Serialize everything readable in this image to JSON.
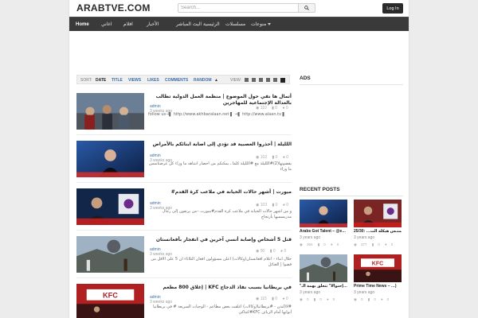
{
  "header": {
    "logo": "ARABTVE.COM",
    "search_placeholder": "Search...",
    "login_label": "Log In"
  },
  "nav": {
    "home": "Home",
    "items": [
      "منوعات",
      "مسلسلات",
      "الرئيسية",
      "البث المباشر",
      "الأخبار",
      "افلام",
      "اغاني"
    ]
  },
  "sortbar": {
    "sort_label": "SORT:",
    "options": [
      "DATE",
      "TITLE",
      "VIEWS",
      "LIKES",
      "COMMENTS",
      "RANDOM"
    ],
    "active": "DATE",
    "view_label": "VIEW:"
  },
  "sidebar": {
    "ads_title": "ADS",
    "recent_title": "RECENT POSTS",
    "recent_posts": [
      {
        "title": "Arabs Got Talent – @e…",
        "time": "3 years ago",
        "views": "384",
        "likes": "0",
        "comments": "0",
        "thumb_color": "#2b3f6e"
      },
      {
        "title": "25/30: …ممتـس هيكلة الث",
        "time": "3 years ago",
        "views": "377",
        "likes": "0",
        "comments": "0",
        "thumb_color": "#7a2424"
      },
      {
        "title": "\"إحتوالا\" تتعلق بهمة الـ…",
        "time": "3 years ago",
        "views": "0",
        "likes": "0",
        "comments": "0",
        "thumb_color": "#1e2f55"
      },
      {
        "title": "Prime Time News – …)",
        "time": "3 years ago",
        "views": "0",
        "likes": "0",
        "comments": "0",
        "thumb_color": "#5b3a2a"
      }
    ]
  },
  "posts": [
    {
      "title": "أتمال ها نفي حول الموضوع | منظمة العمل الدولية تطالب بالعدالة الإجتماعية للمهاجرين",
      "author": "admin",
      "time": "3 weeks ago",
      "views": "110",
      "likes": "0",
      "comments": "0",
      "excerpt": "follow us→▌ http://www.akhbaralaan.net ▌ →▌ http://www.alaan.tv ▌",
      "excerpt_ltr": true,
      "thumb_color": "#6a7f96"
    },
    {
      "title": "اللليلة | أحذروا العصبية قد تؤدي إلى اصابة ابنائكم بالأمراض",
      "author": "admin",
      "time": "3 weeks ago",
      "views": "102",
      "likes": "0",
      "comments": "0",
      "excerpt": "يقضونها(2)#اللليلة مع #اللليلة كلما ـ يمكنكم من أحضار انتباهه ما وراء كل عرضناسس ما وراء",
      "excerpt_ltr": false,
      "thumb_color": "#1d3560"
    },
    {
      "title": "ميورت | أشهر حالات الخيانة في ملاعب كرة القدم#",
      "author": "admin",
      "time": "3 weeks ago",
      "views": "103",
      "likes": "0",
      "comments": "0",
      "excerpt": "و من أشهر حالات الخيانة في ملاعب كرة القدم#ميورت –من يرتقون إلى رجال مدربسسها بأرتجاج",
      "excerpt_ltr": false,
      "thumb_color": "#12264a"
    },
    {
      "title": "قتل 5 أشخاص وإصابة أنسي آخرين في انفجار بأفغانستان",
      "author": "admin",
      "time": "3 weeks ago",
      "views": "90",
      "likes": "0",
      "comments": "0",
      "excerpt": "خلال أبناء - أعلام أفغانستان(وكالات) أعلن مسؤولون أفغان الثلاثاء أن 5 على الأقل من قضوا | الغنائل",
      "excerpt_ltr": false,
      "thumb_color": "#6e7f8e"
    },
    {
      "title": "في بريطانيا بسبب نفاذ الدجاج KFC | إغلاق 800 مطعم",
      "author": "admin",
      "time": "3 weeks ago",
      "views": "115",
      "likes": "0",
      "comments": "0",
      "excerpt": "#لأ(لندن - #بريطانيا(وكالات) أغلقت بعض مطاعم - الوجبات السريعة # في بريطانيا أبوابها أمام الزبائن KFC#كنتاكي",
      "excerpt_ltr": false,
      "thumb_color": "#8a1d1d"
    }
  ]
}
